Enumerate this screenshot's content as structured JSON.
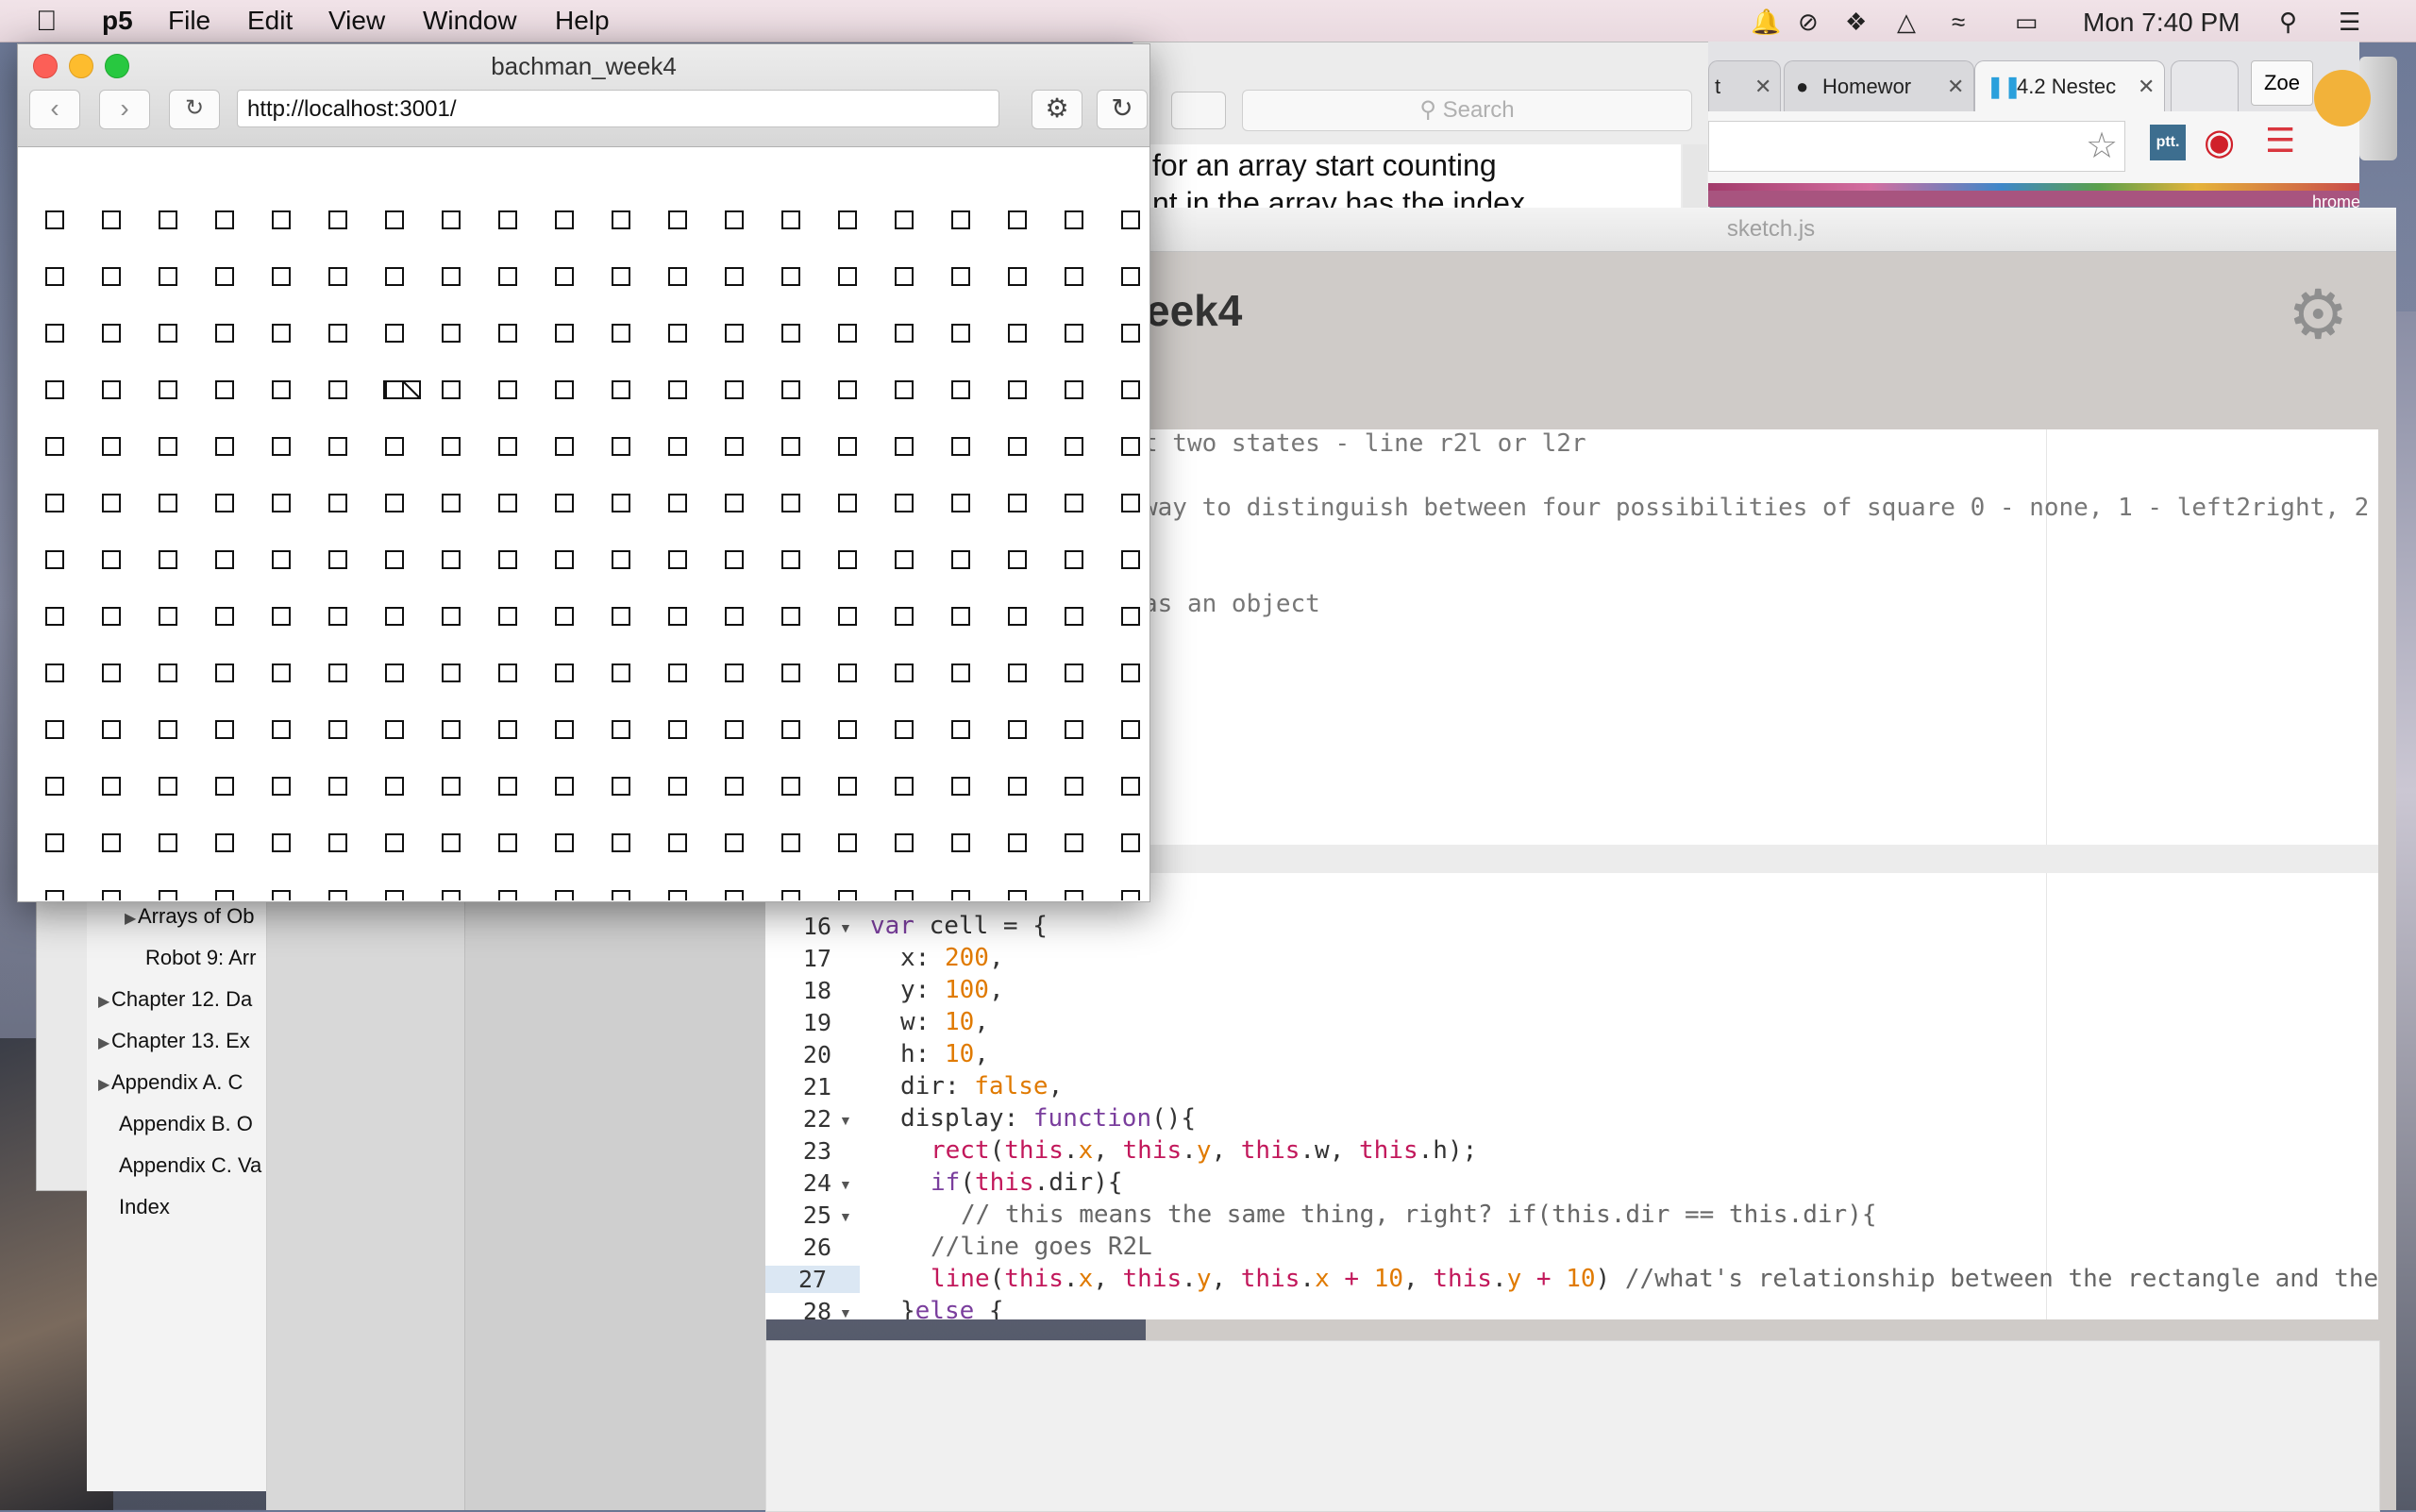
{
  "menubar": {
    "app_name": "p5",
    "items": [
      "File",
      "Edit",
      "View",
      "Window",
      "Help"
    ],
    "clock": "Mon 7:40 PM"
  },
  "preview": {
    "title": "bachman_week4",
    "url": "http://localhost:3001/",
    "grid": {
      "cols": 20,
      "rows": 13,
      "marked_cell": {
        "row": 4,
        "col": 7
      }
    }
  },
  "safari_back": {
    "search_placeholder": "Search",
    "text_line1": "for an array start counting",
    "text_line2": "nt in the array has the index"
  },
  "chrome_back": {
    "tabs": [
      "t",
      "Homewor",
      "4.2 Nestec"
    ],
    "user": "Zoe",
    "ext_label": "ptt.",
    "partial_text": "hrome"
  },
  "ide": {
    "file_name": "sketch.js",
    "project_name": "eek4",
    "comments": [
      "t two states - line r2l or l2r",
      "way to distinguish between four possibilities of square 0 - none, 1 - left2right, 2",
      " as an object"
    ],
    "line_numbers": [
      "16",
      "17",
      "18",
      "19",
      "20",
      "21",
      "22",
      "23",
      "24",
      "25",
      "26",
      "27",
      "28"
    ],
    "current_line": "27"
  },
  "book_toc": {
    "items": [
      {
        "label": "Arrays of Ob",
        "tri": true
      },
      {
        "label": "Robot 9: Arr",
        "tri": false
      },
      {
        "label": "Chapter 12. Da",
        "tri": true
      },
      {
        "label": "Chapter 13. Ex",
        "tri": true
      },
      {
        "label": "Appendix A. C",
        "tri": true
      },
      {
        "label": "Appendix B. O",
        "tri": false
      },
      {
        "label": "Appendix C. Va",
        "tri": false
      },
      {
        "label": "Index",
        "tri": false
      }
    ]
  }
}
